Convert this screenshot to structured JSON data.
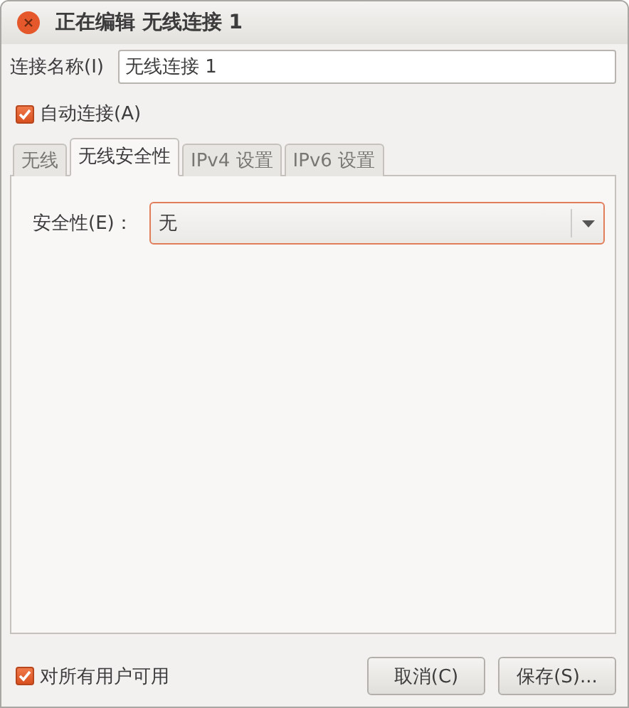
{
  "window": {
    "title": "正在编辑 无线连接 1"
  },
  "connection_name": {
    "label": "连接名称(I)",
    "value": "无线连接 1"
  },
  "auto_connect": {
    "label": "自动连接(A)",
    "checked": true
  },
  "tabs": [
    {
      "label": "无线",
      "selected": false
    },
    {
      "label": "无线安全性",
      "selected": true
    },
    {
      "label": "IPv4 设置",
      "selected": false
    },
    {
      "label": "IPv6 设置",
      "selected": false
    }
  ],
  "security": {
    "label": "安全性(E)：",
    "value": "无"
  },
  "all_users": {
    "label": "对所有用户可用",
    "checked": true
  },
  "buttons": [
    {
      "label": "取消(C)"
    },
    {
      "label": "保存(S)..."
    }
  ]
}
